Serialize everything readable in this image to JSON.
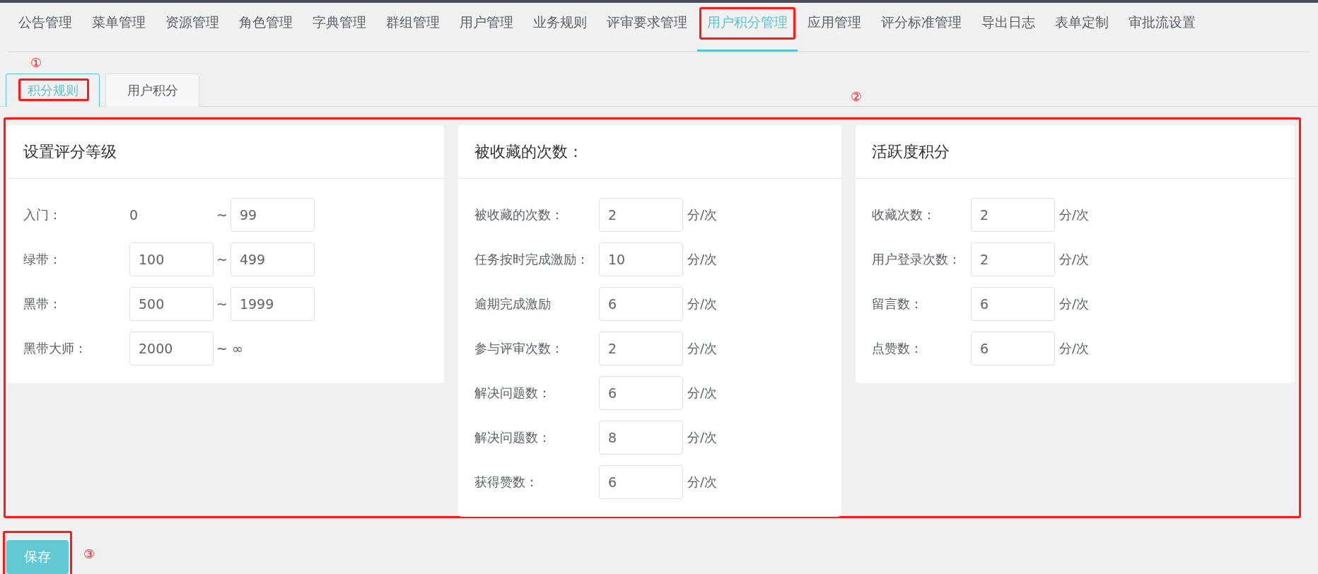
{
  "nav": [
    {
      "label": "公告管理",
      "selected": false,
      "highlighted": false
    },
    {
      "label": "菜单管理",
      "selected": false,
      "highlighted": false
    },
    {
      "label": "资源管理",
      "selected": false,
      "highlighted": false
    },
    {
      "label": "角色管理",
      "selected": false,
      "highlighted": false
    },
    {
      "label": "字典管理",
      "selected": false,
      "highlighted": false
    },
    {
      "label": "群组管理",
      "selected": false,
      "highlighted": false
    },
    {
      "label": "用户管理",
      "selected": false,
      "highlighted": false
    },
    {
      "label": "业务规则",
      "selected": false,
      "highlighted": false
    },
    {
      "label": "评审要求管理",
      "selected": false,
      "highlighted": false
    },
    {
      "label": "用户积分管理",
      "selected": true,
      "highlighted": true
    },
    {
      "label": "应用管理",
      "selected": false,
      "highlighted": false
    },
    {
      "label": "评分标准管理",
      "selected": false,
      "highlighted": false
    },
    {
      "label": "导出日志",
      "selected": false,
      "highlighted": false
    },
    {
      "label": "表单定制",
      "selected": false,
      "highlighted": false
    },
    {
      "label": "审批流设置",
      "selected": false,
      "highlighted": false
    }
  ],
  "tabs_callout": "①",
  "tabs": [
    {
      "label": "积分规则",
      "selected": true,
      "highlighted": true
    },
    {
      "label": "用户积分",
      "selected": false,
      "highlighted": false
    }
  ],
  "panel": {
    "highlighted": true,
    "callout": "②",
    "cards": [
      {
        "title": "设置评分等级",
        "kind": "range",
        "rows": [
          {
            "label": "入门：",
            "fields": [
              {
                "kind": "text",
                "value": "0"
              },
              {
                "kind": "sep",
                "value": "~"
              },
              {
                "kind": "input",
                "value": "99"
              }
            ]
          },
          {
            "label": "绿带：",
            "fields": [
              {
                "kind": "input",
                "value": "100"
              },
              {
                "kind": "sep",
                "value": "~"
              },
              {
                "kind": "input",
                "value": "499"
              }
            ]
          },
          {
            "label": "黑带：",
            "fields": [
              {
                "kind": "input",
                "value": "500"
              },
              {
                "kind": "sep",
                "value": "~"
              },
              {
                "kind": "input",
                "value": "1999"
              }
            ]
          },
          {
            "label": "黑带大师：",
            "fields": [
              {
                "kind": "input",
                "value": "2000"
              },
              {
                "kind": "sep",
                "value": "~ ∞"
              }
            ]
          }
        ]
      },
      {
        "title": "被收藏的次数：",
        "kind": "points",
        "rows": [
          {
            "label": "被收藏的次数：",
            "value": "2",
            "unit": "分/次"
          },
          {
            "label": "任务按时完成激励：",
            "value": "10",
            "unit": "分/次"
          },
          {
            "label": "逾期完成激励",
            "value": "6",
            "unit": "分/次"
          },
          {
            "label": "参与评审次数：",
            "value": "2",
            "unit": "分/次"
          },
          {
            "label": "解决问题数：",
            "value": "6",
            "unit": "分/次"
          },
          {
            "label": "解决问题数：",
            "value": "8",
            "unit": "分/次"
          },
          {
            "label": "获得赞数：",
            "value": "6",
            "unit": "分/次"
          }
        ]
      },
      {
        "title": "活跃度积分",
        "kind": "points",
        "rows": [
          {
            "label": "收藏次数：",
            "value": "2",
            "unit": "分/次"
          },
          {
            "label": "用户登录次数：",
            "value": "2",
            "unit": "分/次"
          },
          {
            "label": "留言数：",
            "value": "6",
            "unit": "分/次"
          },
          {
            "label": "点赞数：",
            "value": "6",
            "unit": "分/次"
          }
        ]
      }
    ]
  },
  "save_button": {
    "label": "保存",
    "highlighted": true,
    "callout": "③"
  }
}
